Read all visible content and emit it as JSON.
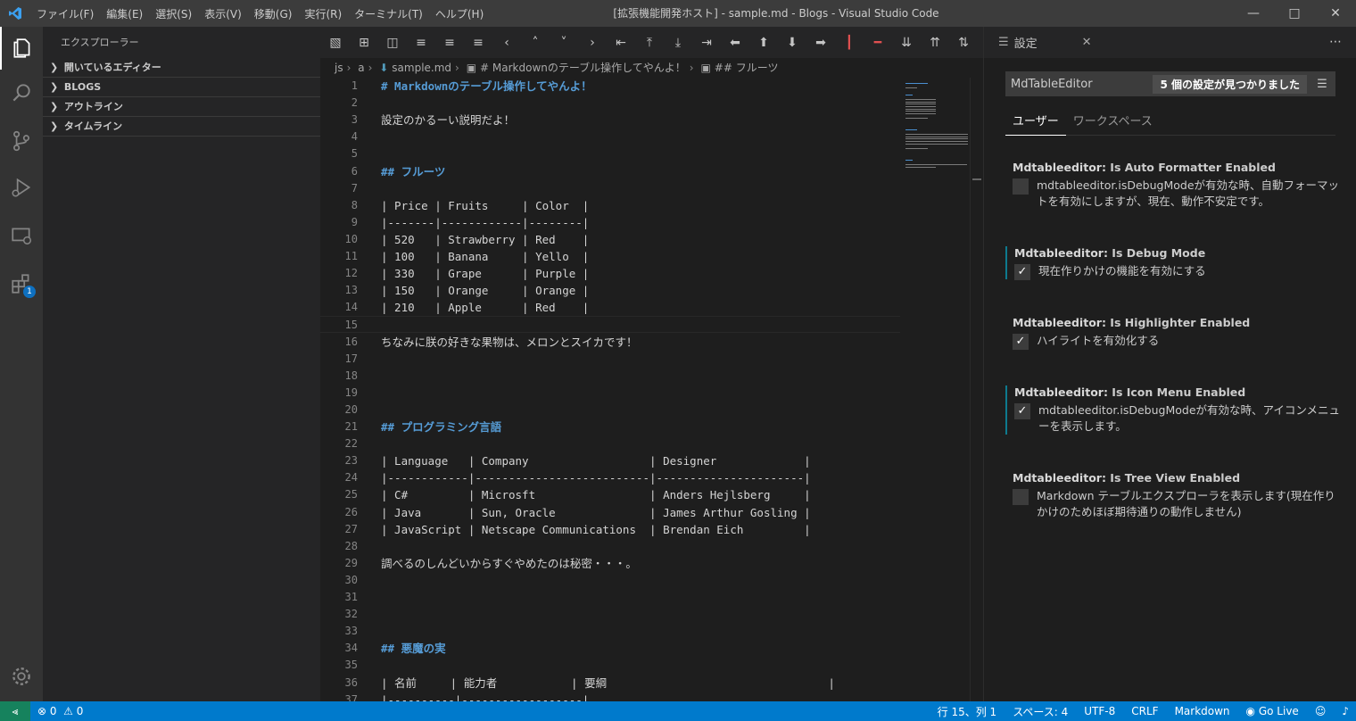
{
  "titlebar": {
    "menu": [
      "ファイル(F)",
      "編集(E)",
      "選択(S)",
      "表示(V)",
      "移動(G)",
      "実行(R)",
      "ターミナル(T)",
      "ヘルプ(H)"
    ],
    "title": "[拡張機能開発ホスト] - sample.md - Blogs - Visual Studio Code"
  },
  "activity": {
    "extensions_badge": "1"
  },
  "sidebar": {
    "title": "エクスプローラー",
    "sections": [
      "開いているエディター",
      "BLOGS",
      "アウトライン",
      "タイムライン"
    ]
  },
  "breadcrumb": [
    "js",
    "a",
    "sample.md",
    "# Markdownのテーブル操作してやんよ！",
    "## フルーツ"
  ],
  "editor": {
    "lines": [
      {
        "n": "1",
        "t": "# Markdownのテーブル操作してやんよ！",
        "h": true
      },
      {
        "n": "2",
        "t": ""
      },
      {
        "n": "3",
        "t": "設定のかるーい説明だよ！"
      },
      {
        "n": "4",
        "t": ""
      },
      {
        "n": "5",
        "t": ""
      },
      {
        "n": "6",
        "t": "## フルーツ",
        "h": true
      },
      {
        "n": "7",
        "t": ""
      },
      {
        "n": "8",
        "t": "| Price | Fruits     | Color  |"
      },
      {
        "n": "9",
        "t": "|-------|------------|--------|"
      },
      {
        "n": "10",
        "t": "| 520   | Strawberry | Red    |"
      },
      {
        "n": "11",
        "t": "| 100   | Banana     | Yello  |"
      },
      {
        "n": "12",
        "t": "| 330   | Grape      | Purple |"
      },
      {
        "n": "13",
        "t": "| 150   | Orange     | Orange |"
      },
      {
        "n": "14",
        "t": "| 210   | Apple      | Red    |"
      },
      {
        "n": "15",
        "t": "",
        "cur": true
      },
      {
        "n": "16",
        "t": "ちなみに朕の好きな果物は、メロンとスイカです！"
      },
      {
        "n": "17",
        "t": ""
      },
      {
        "n": "18",
        "t": ""
      },
      {
        "n": "19",
        "t": ""
      },
      {
        "n": "20",
        "t": ""
      },
      {
        "n": "21",
        "t": "## プログラミング言語",
        "h": true
      },
      {
        "n": "22",
        "t": ""
      },
      {
        "n": "23",
        "t": "| Language   | Company                  | Designer             |"
      },
      {
        "n": "24",
        "t": "|------------|--------------------------|----------------------|"
      },
      {
        "n": "25",
        "t": "| C#         | Microsft                 | Anders Hejlsberg     |"
      },
      {
        "n": "26",
        "t": "| Java       | Sun, Oracle              | James Arthur Gosling |"
      },
      {
        "n": "27",
        "t": "| JavaScript | Netscape Communications  | Brendan Eich         |"
      },
      {
        "n": "28",
        "t": ""
      },
      {
        "n": "29",
        "t": "調べるのしんどいからすぐやめたのは秘密・・・。"
      },
      {
        "n": "30",
        "t": ""
      },
      {
        "n": "31",
        "t": ""
      },
      {
        "n": "32",
        "t": ""
      },
      {
        "n": "33",
        "t": ""
      },
      {
        "n": "34",
        "t": "## 悪魔の実",
        "h": true
      },
      {
        "n": "35",
        "t": ""
      },
      {
        "n": "36",
        "t": "| 名前     | 能力者           | 要綱                                 |"
      },
      {
        "n": "37",
        "t": "|----------|------------------|"
      }
    ]
  },
  "settings": {
    "tab_title": "設定",
    "search_value": "MdTableEditor",
    "search_count": "5 個の設定が見つかりました",
    "scopes": [
      "ユーザー",
      "ワークスペース"
    ],
    "items": [
      {
        "prefix": "Mdtableeditor: ",
        "name": "Is Auto Formatter Enabled",
        "desc": "mdtableeditor.isDebugModeが有効な時、自動フォーマットを有効にしますが、現在、動作不安定です。",
        "checked": false,
        "modified": false
      },
      {
        "prefix": "Mdtableeditor: ",
        "name": "Is Debug Mode",
        "desc": "現在作りかけの機能を有効にする",
        "checked": true,
        "modified": true
      },
      {
        "prefix": "Mdtableeditor: ",
        "name": "Is Highlighter Enabled",
        "desc": "ハイライトを有効化する",
        "checked": true,
        "modified": false
      },
      {
        "prefix": "Mdtableeditor: ",
        "name": "Is Icon Menu Enabled",
        "desc": "mdtableeditor.isDebugModeが有効な時、アイコンメニューを表示します。",
        "checked": true,
        "modified": true
      },
      {
        "prefix": "Mdtableeditor: ",
        "name": "Is Tree View Enabled",
        "desc": "Markdown テーブルエクスプローラを表示します(現在作りかけのためほぼ期待通りの動作しません)",
        "checked": false,
        "modified": false
      }
    ]
  },
  "statusbar": {
    "problems": "0",
    "warnings": "0",
    "position": "行 15、列 1",
    "spaces": "スペース: 4",
    "encoding": "UTF-8",
    "eol": "CRLF",
    "language": "Markdown",
    "golive": "Go Live"
  }
}
